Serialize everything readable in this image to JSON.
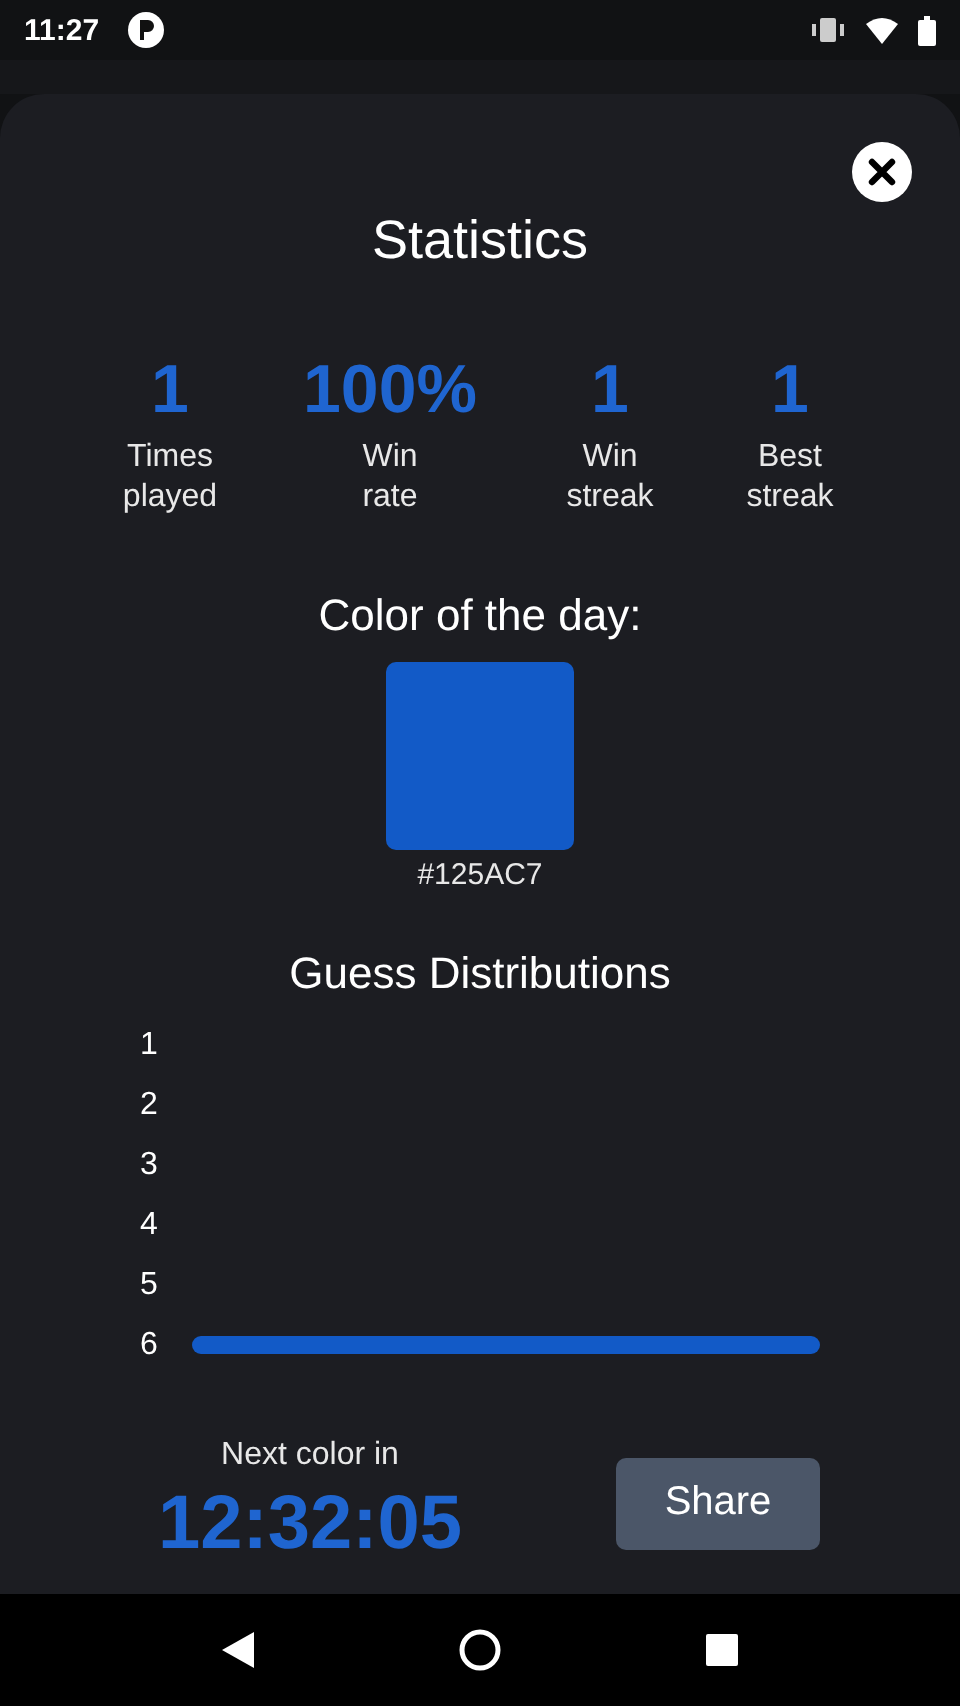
{
  "status_bar": {
    "time": "11:27"
  },
  "dialog": {
    "title": "Statistics",
    "stats": [
      {
        "value": "1",
        "label": "Times played"
      },
      {
        "value": "100%",
        "label": "Win rate"
      },
      {
        "value": "1",
        "label": "Win streak"
      },
      {
        "value": "1",
        "label": "Best streak"
      }
    ],
    "color_of_day": {
      "heading": "Color of the day:",
      "color": "#125ac7",
      "hex": "#125AC7"
    },
    "distribution": {
      "title": "Guess Distributions",
      "rows": [
        {
          "label": "1"
        },
        {
          "label": "2"
        },
        {
          "label": "3"
        },
        {
          "label": "4"
        },
        {
          "label": "5"
        },
        {
          "label": "6",
          "level": 1
        }
      ]
    },
    "countdown": {
      "label": "Next color in",
      "time": "12:32:05"
    },
    "share_button": "Share"
  }
}
